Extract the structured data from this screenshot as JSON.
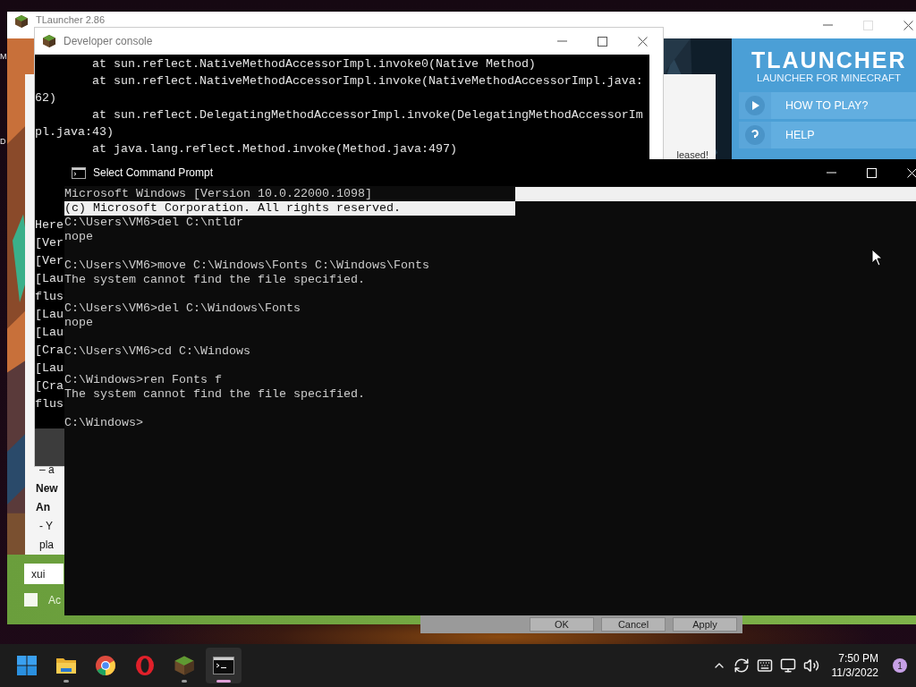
{
  "desktop": {
    "icon_labels": [
      "M",
      "D"
    ]
  },
  "launcher": {
    "title": "TLauncher 2.86",
    "logo": "TLAUNCHER",
    "tagline": "LAUNCHER FOR MINECRAFT",
    "menu": [
      {
        "label": "HOW TO PLAY?",
        "kind": "play"
      },
      {
        "label": "HELP",
        "kind": "help"
      }
    ],
    "news": {
      "heading_tail": "leased!",
      "lines": [
        {
          "text": "– a",
          "bold": false
        },
        {
          "text": "New",
          "bold": true
        },
        {
          "text": "An",
          "bold": true
        },
        {
          "text": "- Y",
          "bold": false
        },
        {
          "text": "pla",
          "bold": false
        }
      ]
    },
    "account": {
      "value": "xui"
    },
    "option": {
      "label": "Ac",
      "checked": false
    }
  },
  "settings_dialog": {
    "buttons": [
      "OK",
      "Cancel",
      "Apply"
    ]
  },
  "dev_console": {
    "title": "Developer console",
    "trace_lines": [
      "        at sun.reflect.NativeMethodAccessorImpl.invoke0(Native Method)",
      "        at sun.reflect.NativeMethodAccessorImpl.invoke(NativeMethodAccessorImpl.java:",
      "62)",
      "        at sun.reflect.DelegatingMethodAccessorImpl.invoke(DelegatingMethodAccessorIm",
      "pl.java:43)",
      "        at java.lang.reflect.Method.invoke(Method.java:497)"
    ],
    "log_lines": [
      "Here",
      "[Ver",
      "[Ver",
      "[Lau",
      "flus",
      "[Lau",
      "[Lau",
      "[Cra",
      "[Lau",
      "[Cra",
      "flus"
    ]
  },
  "command_prompt": {
    "title": "Select Command Prompt",
    "blocks": [
      {
        "lines": [
          {
            "text": "Microsoft Windows [Version 10.0.22000.1098]",
            "selected": false
          },
          {
            "text": "(c) Microsoft Corporation. All rights reserved.",
            "selected": true
          },
          {
            "text": "C:\\Users\\VM6>del C:\\ntldr",
            "selected": false
          },
          {
            "text": "nope",
            "selected": false
          }
        ]
      },
      {
        "lines": [
          {
            "text": "C:\\Users\\VM6>move C:\\Windows\\Fonts C:\\Windows\\Fonts",
            "selected": false
          },
          {
            "text": "The system cannot find the file specified.",
            "selected": false
          }
        ]
      },
      {
        "lines": [
          {
            "text": "C:\\Users\\VM6>del C:\\Windows\\Fonts",
            "selected": false
          },
          {
            "text": "nope",
            "selected": false
          }
        ]
      },
      {
        "lines": [
          {
            "text": "C:\\Users\\VM6>cd C:\\Windows",
            "selected": false
          }
        ]
      },
      {
        "lines": [
          {
            "text": "C:\\Windows>ren Fonts f",
            "selected": false
          },
          {
            "text": "The system cannot find the file specified.",
            "selected": false
          }
        ]
      },
      {
        "lines": [
          {
            "text": "C:\\Windows>",
            "selected": false
          }
        ]
      }
    ]
  },
  "taskbar": {
    "apps": [
      {
        "kind": "start",
        "running": false,
        "selected": false
      },
      {
        "kind": "folder",
        "running": true,
        "selected": false
      },
      {
        "kind": "browser",
        "running": false,
        "selected": false
      },
      {
        "kind": "ring",
        "running": false,
        "selected": false
      },
      {
        "kind": "block",
        "running": true,
        "selected": false
      },
      {
        "kind": "terminal",
        "running": true,
        "selected": true
      }
    ],
    "time": "7:50 PM",
    "date": "11/3/2022",
    "notifications": "1"
  }
}
